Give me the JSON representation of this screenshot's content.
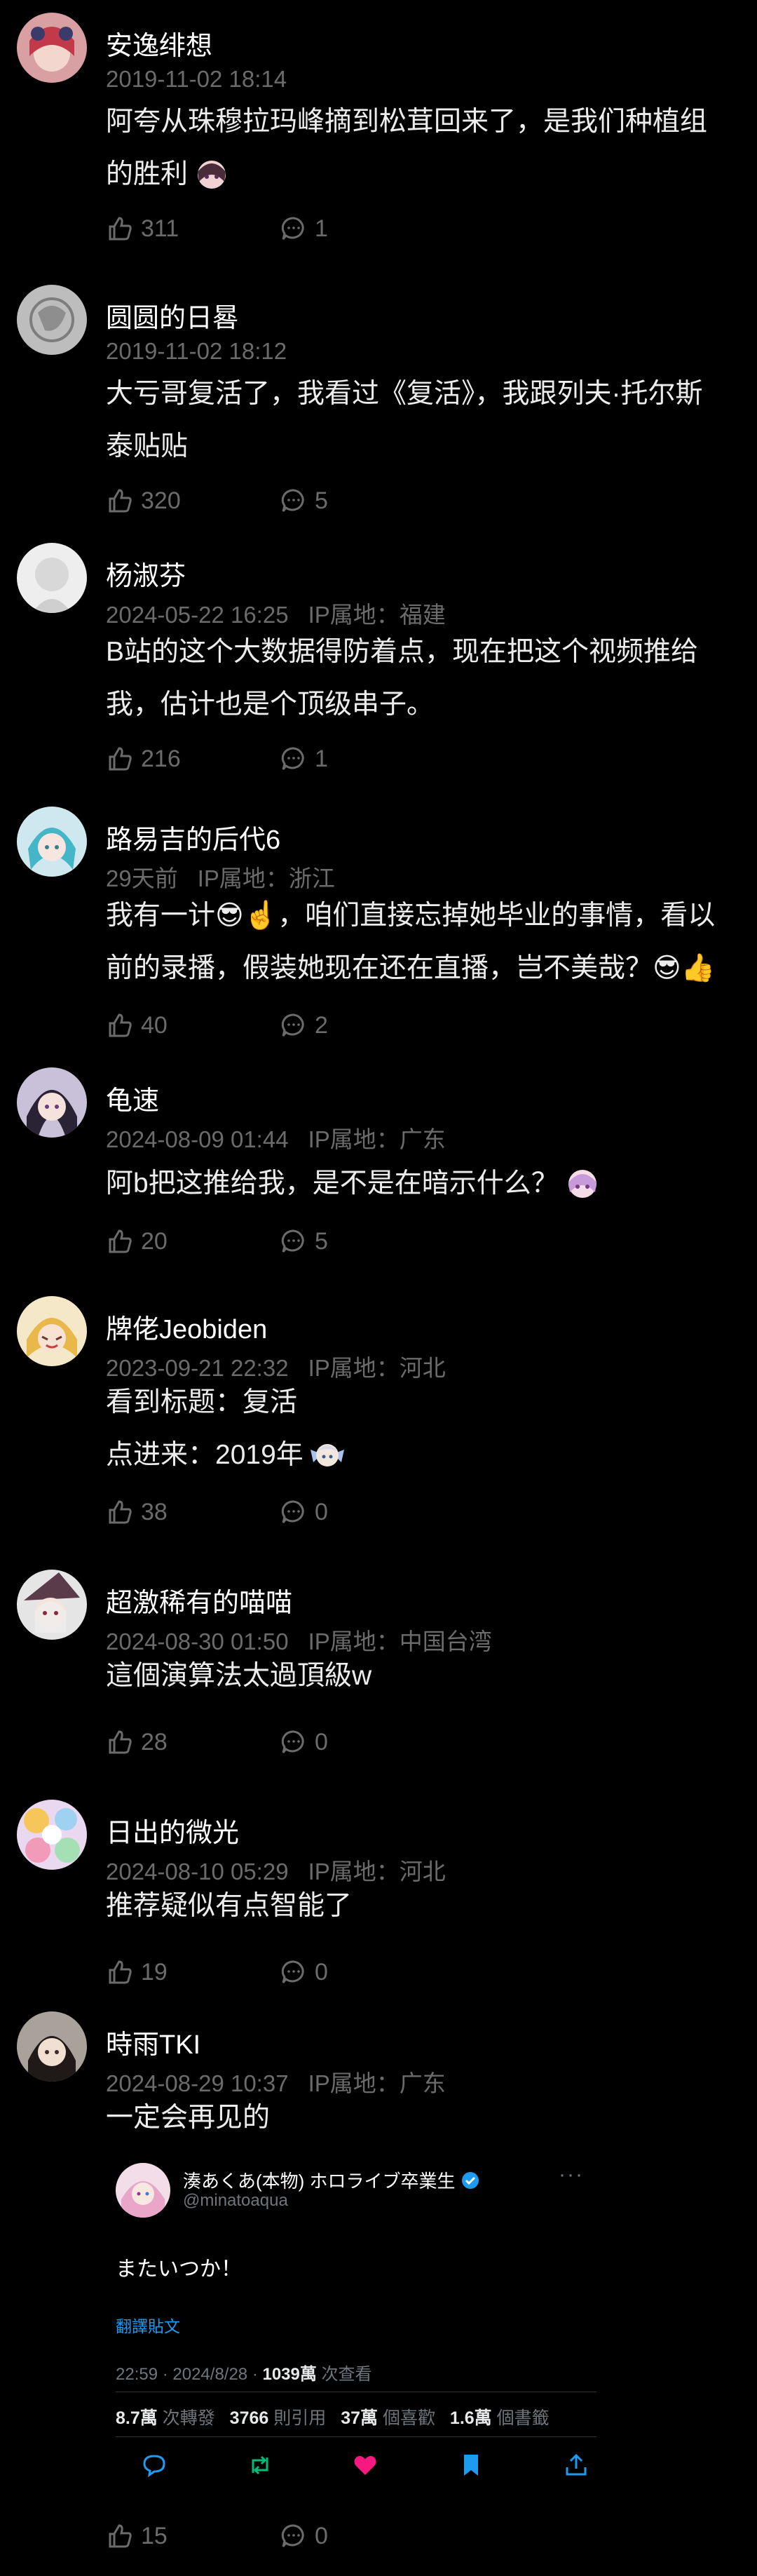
{
  "labels": {
    "ip_prefix": "IP属地："
  },
  "colors": {
    "background": "#000000",
    "username": "#ffffff",
    "meta": "#6b6b6b",
    "content": "#ececec",
    "retweet_green": "#00ba7c",
    "like_pink": "#f91880",
    "bookmark_blue": "#1d9bf0"
  },
  "comments": [
    {
      "username": "安逸绯想",
      "time": "2019-11-02 18:14",
      "ip": "",
      "content": [
        "阿夸从珠穆拉玛峰摘到松茸回来了，是我们种植组",
        "的胜利"
      ],
      "likes": "311",
      "replies": "1"
    },
    {
      "username": "圆圆的日晷",
      "time": "2019-11-02 18:12",
      "ip": "",
      "content": [
        "大亏哥复活了，我看过《复活》，我跟列夫·托尔斯",
        "泰贴贴"
      ],
      "likes": "320",
      "replies": "5"
    },
    {
      "username": "杨淑芬",
      "time": "2024-05-22 16:25",
      "ip": "福建",
      "content": [
        "B站的这个大数据得防着点，现在把这个视频推给",
        "我，估计也是个顶级串子。"
      ],
      "likes": "216",
      "replies": "1"
    },
    {
      "username": "路易吉的后代6",
      "time": "29天前",
      "ip": "浙江",
      "content": [
        "我有一计😎☝️，咱们直接忘掉她毕业的事情，看以",
        "前的录播，假装她现在还在直播，岂不美哉？😎👍"
      ],
      "likes": "40",
      "replies": "2"
    },
    {
      "username": "龟速",
      "time": "2024-08-09 01:44",
      "ip": "广东",
      "content": [
        "阿b把这推给我，是不是在暗示什么？"
      ],
      "likes": "20",
      "replies": "5"
    },
    {
      "username": "牌佬Jeobiden",
      "time": "2023-09-21 22:32",
      "ip": "河北",
      "content": [
        "看到标题：复活",
        "点进来：2019年"
      ],
      "likes": "38",
      "replies": "0"
    },
    {
      "username": "超激稀有的喵喵",
      "time": "2024-08-30 01:50",
      "ip": "中国台湾",
      "content": [
        "這個演算法太過頂級w"
      ],
      "likes": "28",
      "replies": "0"
    },
    {
      "username": "日出的微光",
      "time": "2024-08-10 05:29",
      "ip": "河北",
      "content": [
        "推荐疑似有点智能了"
      ],
      "likes": "19",
      "replies": "0"
    },
    {
      "username": "時雨TKI",
      "time": "2024-08-29 10:37",
      "ip": "广东",
      "content": [
        "一定会再见的"
      ],
      "likes": "15",
      "replies": "0"
    }
  ],
  "tweet": {
    "name": "湊あくあ(本物) ホロライブ卒業生",
    "handle": "@minatoaqua",
    "more": "···",
    "text": "またいつか！",
    "translate": "翻譯貼文",
    "time_prefix": "22:59 · 2024/8/28 · ",
    "views": "1039萬",
    "views_label": " 次查看",
    "retweets": "8.7萬",
    "retweets_label": " 次轉發",
    "quotes": "3766",
    "quotes_label": " 則引用",
    "likes": "37萬",
    "likes_label": " 個喜歡",
    "bookmarks": "1.6萬",
    "bookmarks_label": " 個書籤"
  }
}
